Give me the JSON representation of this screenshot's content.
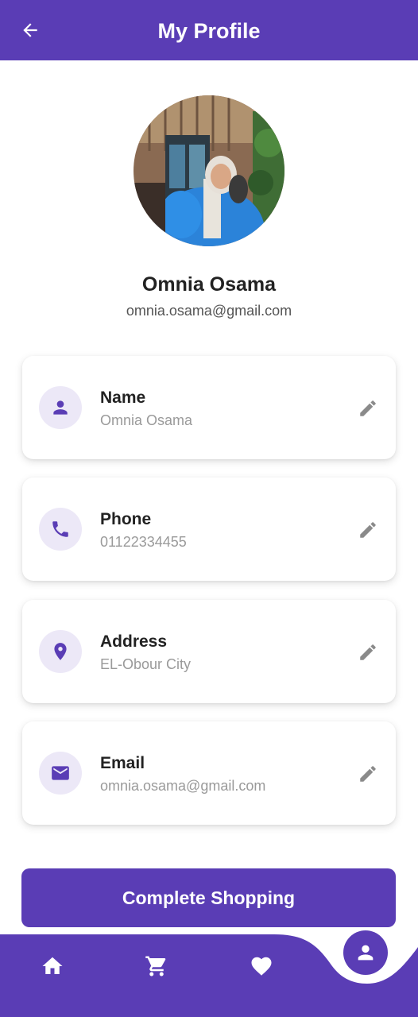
{
  "colors": {
    "primary": "#5a3db5",
    "icon_bg": "#ece8f7",
    "edit_icon": "#8a8a8a",
    "muted_text": "#9a9a9a"
  },
  "header": {
    "title": "My Profile",
    "back_icon": "arrow-back-icon"
  },
  "profile": {
    "name": "Omnia Osama",
    "email": "omnia.osama@gmail.com"
  },
  "fields": [
    {
      "label": "Name",
      "value": "Omnia Osama",
      "icon": "person-icon"
    },
    {
      "label": "Phone",
      "value": "01122334455",
      "icon": "phone-icon"
    },
    {
      "label": "Address",
      "value": "EL-Obour City",
      "icon": "location-pin-icon"
    },
    {
      "label": "Email",
      "value": "omnia.osama@gmail.com",
      "icon": "mail-icon"
    }
  ],
  "cta": {
    "label": "Complete Shopping"
  },
  "bottom_nav": {
    "items": [
      "home-icon",
      "cart-icon",
      "heart-icon",
      "profile-icon"
    ],
    "active": "profile-icon"
  }
}
